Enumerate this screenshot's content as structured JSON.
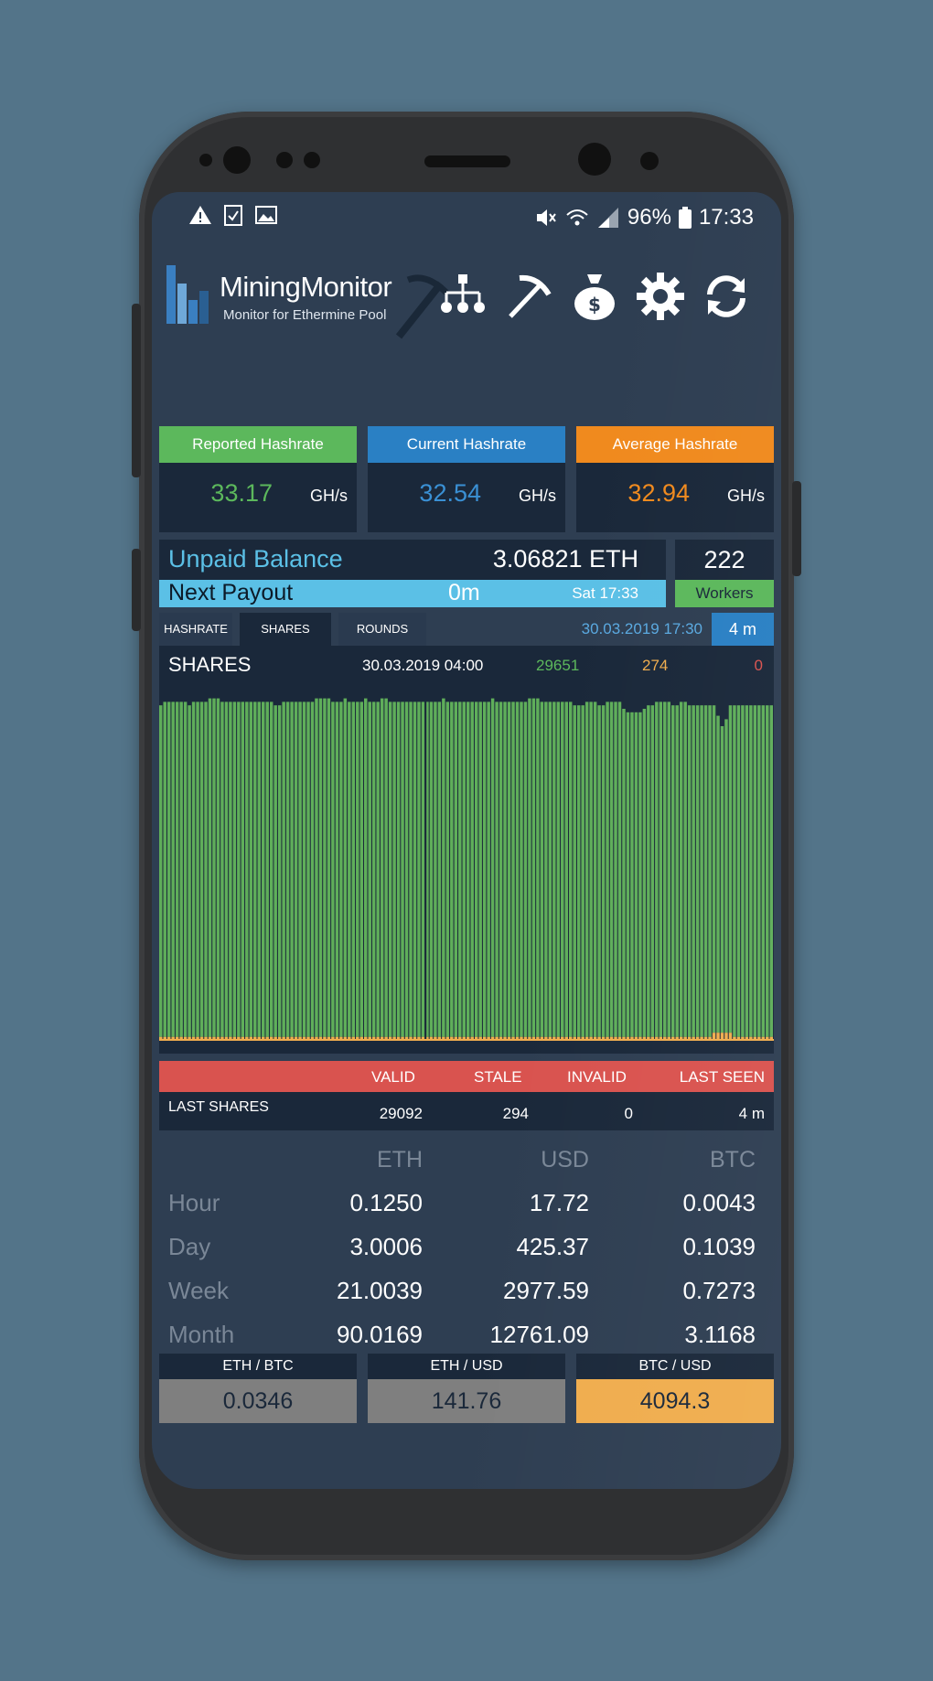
{
  "statusbar": {
    "battery": "96%",
    "time": "17:33"
  },
  "app": {
    "title": "MiningMonitor",
    "subtitle": "Monitor for Ethermine Pool"
  },
  "hashrate": {
    "reported": {
      "label": "Reported Hashrate",
      "value": "33.17",
      "unit": "GH/s",
      "color": "#5cb85c"
    },
    "current": {
      "label": "Current Hashrate",
      "value": "32.54",
      "unit": "GH/s",
      "color": "#2a80c4"
    },
    "average": {
      "label": "Average Hashrate",
      "value": "32.94",
      "unit": "GH/s",
      "color": "#f08a1e"
    }
  },
  "balance": {
    "label": "Unpaid Balance",
    "value": "3.06821 ETH"
  },
  "payout": {
    "label": "Next Payout",
    "value": "0m",
    "time": "Sat 17:33"
  },
  "workers": {
    "count": "222",
    "label": "Workers"
  },
  "tabs": {
    "hashrate": "HASHRATE",
    "shares": "SHARES",
    "rounds": "ROUNDS",
    "date": "30.03.2019 17:30",
    "age": "4 m"
  },
  "chart_data": {
    "type": "bar",
    "title": "SHARES",
    "header": {
      "date": "30.03.2019 04:00",
      "valid": "29651",
      "stale": "274",
      "invalid": "0"
    },
    "series": [
      {
        "name": "valid",
        "color": "#5fae5a",
        "values": [
          96,
          97,
          97,
          97,
          97,
          97,
          97,
          96,
          97,
          97,
          97,
          97,
          98,
          98,
          98,
          97,
          97,
          97,
          97,
          97,
          97,
          97,
          97,
          97,
          97,
          97,
          97,
          97,
          96,
          96,
          97,
          97,
          97,
          97,
          97,
          97,
          97,
          97,
          98,
          98,
          98,
          98,
          97,
          97,
          97,
          98,
          97,
          97,
          97,
          97,
          98,
          97,
          97,
          97,
          98,
          98,
          97,
          97,
          97,
          97,
          97,
          97,
          97,
          97,
          97,
          97,
          97,
          97,
          97,
          98,
          97,
          97,
          97,
          97,
          97,
          97,
          97,
          97,
          97,
          97,
          97,
          98,
          97,
          97,
          97,
          97,
          97,
          97,
          97,
          97,
          98,
          98,
          98,
          97,
          97,
          97,
          97,
          97,
          97,
          97,
          97,
          96,
          96,
          96,
          97,
          97,
          97,
          96,
          96,
          97,
          97,
          97,
          97,
          95,
          94,
          94,
          94,
          94,
          95,
          96,
          96,
          97,
          97,
          97,
          97,
          96,
          96,
          97,
          97,
          96,
          96,
          96,
          96,
          96,
          96,
          96,
          93,
          90,
          92,
          96,
          96,
          96,
          96,
          96,
          96,
          96,
          96,
          96,
          96,
          96
        ]
      },
      {
        "name": "stale",
        "color": "#f0ad4e",
        "values": [
          0.6,
          0.6,
          0.6,
          0.6,
          0.6,
          0.6,
          0.6,
          0.6,
          0.6,
          0.6,
          0.6,
          0.6,
          0.6,
          0.6,
          0.6,
          0.6,
          0.6,
          0.6,
          0.6,
          0.6,
          0.6,
          0.6,
          0.6,
          0.6,
          0.6,
          0.6,
          0.6,
          0.6,
          0.6,
          0.6,
          0.6,
          0.6,
          0.6,
          0.6,
          0.6,
          0.6,
          0.6,
          0.6,
          0.6,
          0.6,
          0.6,
          0.6,
          0.6,
          0.6,
          0.6,
          0.6,
          0.6,
          0.6,
          0.6,
          0.6,
          0.6,
          0.6,
          0.6,
          0.6,
          0.6,
          0.6,
          0.6,
          0.6,
          0.6,
          0.6,
          0.6,
          0.6,
          0.6,
          0.6,
          0.6,
          0.6,
          0.6,
          0.6,
          0.6,
          0.6,
          0.6,
          0.6,
          0.6,
          0.6,
          0.6,
          0.6,
          0.6,
          0.6,
          0.6,
          0.6,
          0.6,
          0.6,
          0.6,
          0.6,
          0.6,
          0.6,
          0.6,
          0.6,
          0.6,
          0.6,
          0.6,
          0.6,
          0.6,
          0.6,
          0.6,
          0.6,
          0.6,
          0.6,
          0.6,
          0.6,
          0.6,
          0.6,
          0.6,
          0.6,
          0.6,
          0.6,
          0.6,
          0.6,
          0.6,
          0.6,
          0.6,
          0.6,
          0.6,
          0.6,
          0.6,
          0.6,
          0.6,
          0.6,
          0.6,
          0.6,
          0.6,
          0.6,
          0.6,
          0.6,
          0.6,
          0.6,
          0.6,
          0.6,
          0.6,
          0.6,
          0.6,
          0.6,
          0.6,
          0.6,
          0.6,
          1.8,
          1.8,
          1.8,
          1.8,
          1.8,
          0.6,
          0.6,
          0.6,
          0.6,
          0.6,
          0.6,
          0.6,
          0.6,
          0.6,
          0.6
        ]
      }
    ],
    "ylim": [
      0,
      100
    ]
  },
  "last_shares": {
    "headers": {
      "valid": "VALID",
      "stale": "STALE",
      "invalid": "INVALID",
      "last_seen": "LAST SEEN"
    },
    "label": "LAST SHARES",
    "valid": "29092",
    "stale": "294",
    "invalid": "0",
    "last_seen": "4 m"
  },
  "earnings": {
    "headers": {
      "eth": "ETH",
      "usd": "USD",
      "btc": "BTC"
    },
    "rows": [
      {
        "label": "Hour",
        "eth": "0.1250",
        "usd": "17.72",
        "btc": "0.0043"
      },
      {
        "label": "Day",
        "eth": "3.0006",
        "usd": "425.37",
        "btc": "0.1039"
      },
      {
        "label": "Week",
        "eth": "21.0039",
        "usd": "2977.59",
        "btc": "0.7273"
      },
      {
        "label": "Month",
        "eth": "90.0169",
        "usd": "12761.09",
        "btc": "3.1168"
      }
    ]
  },
  "rates": {
    "eth_btc": {
      "label": "ETH / BTC",
      "value": "0.0346",
      "color": "#7f7f7f"
    },
    "eth_usd": {
      "label": "ETH / USD",
      "value": "141.76",
      "color": "#7f7f7f"
    },
    "btc_usd": {
      "label": "BTC / USD",
      "value": "4094.3",
      "color": "#f0ad4e"
    }
  }
}
